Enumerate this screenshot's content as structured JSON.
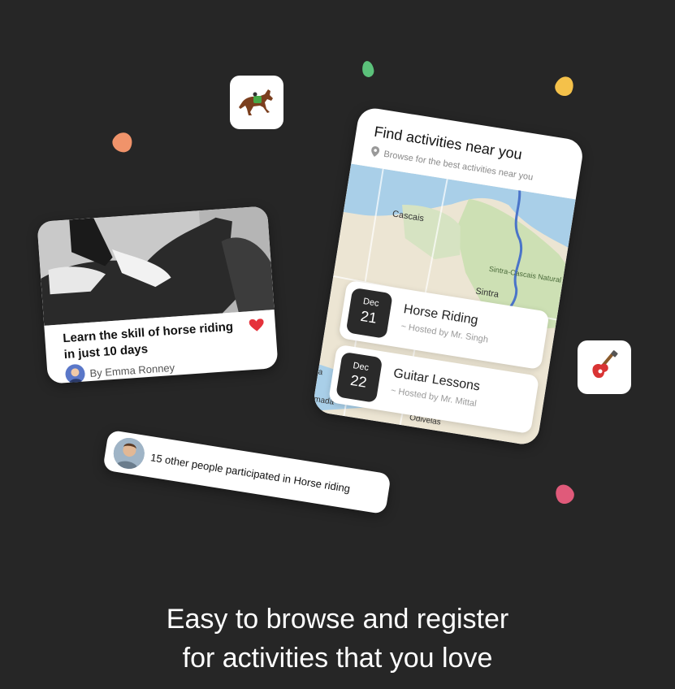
{
  "colors": {
    "background": "#262626",
    "accent_green": "#5bc17a",
    "accent_yellow": "#f4c14a",
    "accent_orange": "#f0936a",
    "accent_pink": "#e05a7a",
    "heart": "#e5323b"
  },
  "icons": {
    "horse": "horse-emoji",
    "guitar": "guitar-emoji",
    "heart": "heart-icon",
    "pin": "location-pin-icon"
  },
  "horse_card": {
    "title": "Learn the skill of horse riding in just 10 days",
    "author": "By Emma Ronney"
  },
  "participants": {
    "text": "15 other people participated in Horse riding"
  },
  "map_card": {
    "title": "Find activities near you",
    "subtitle": "Browse for the best activities near you",
    "map_labels": {
      "cascais": "Cascais",
      "park": "Sintra-Cascais Natural Park",
      "sintra": "Sintra",
      "odivelas": "Odivelas",
      "amadora": "mada",
      "left_edge": "a"
    },
    "events": [
      {
        "month": "Dec",
        "day": "21",
        "title": "Horse Riding",
        "host": "~ Hosted by Mr. Singh"
      },
      {
        "month": "Dec",
        "day": "22",
        "title": "Guitar Lessons",
        "host": "~ Hosted by Mr. Mittal"
      }
    ]
  },
  "headline": {
    "line1": "Easy to browse and register",
    "line2": "for activities that you love"
  }
}
